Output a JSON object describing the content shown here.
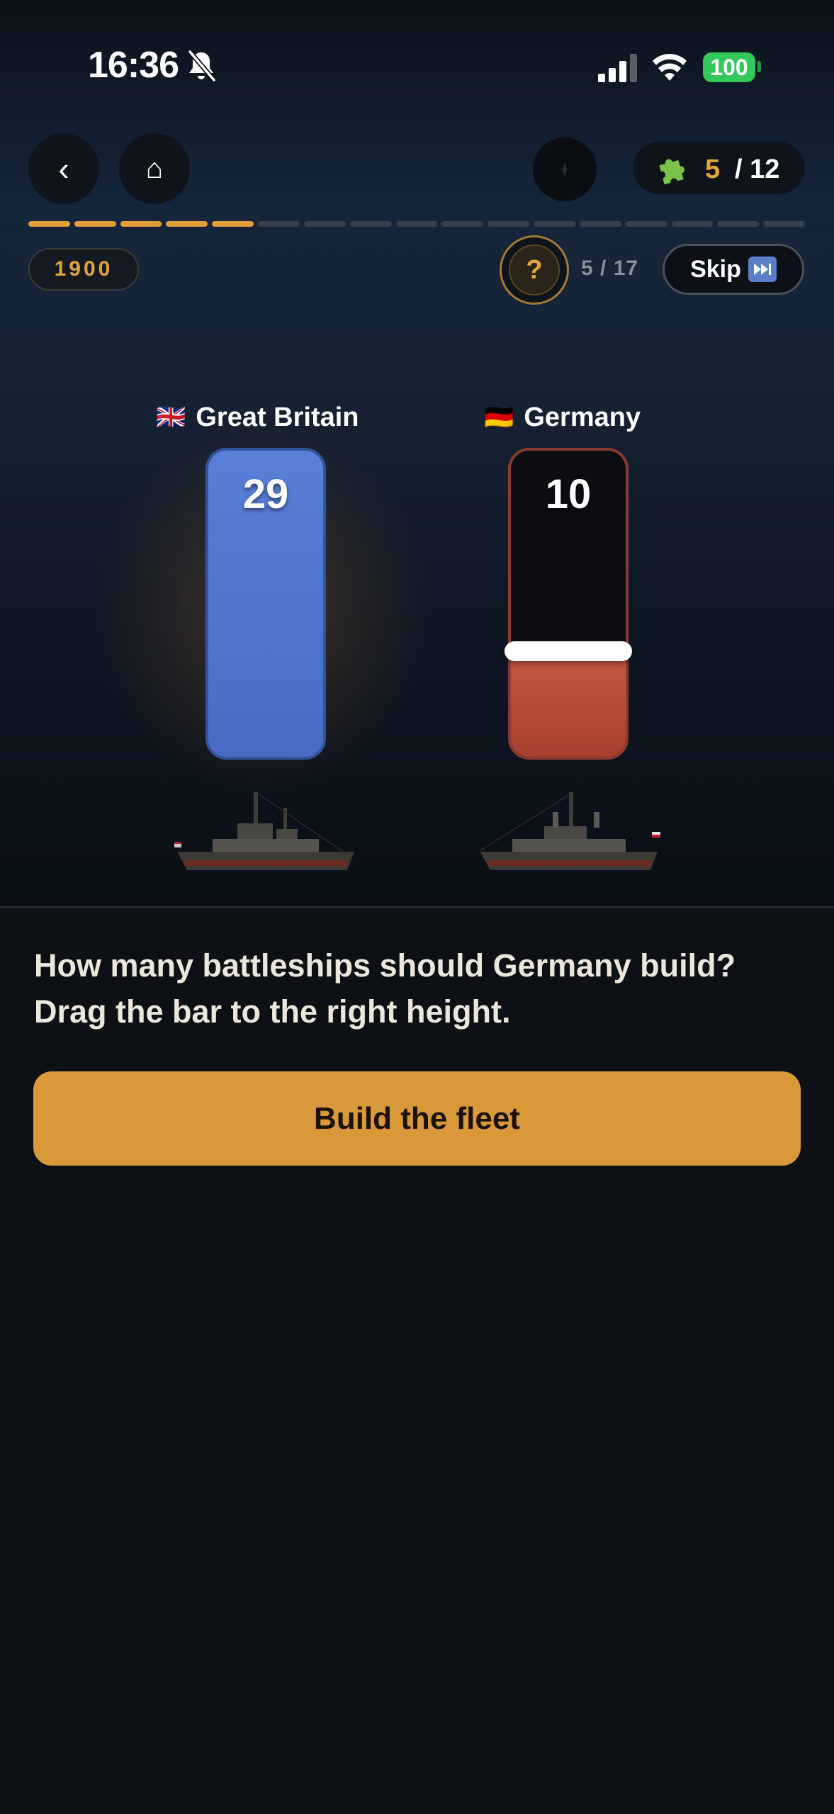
{
  "status_bar": {
    "time": "16:36",
    "battery": "100"
  },
  "nav": {
    "back_glyph": "‹",
    "home_glyph": "⌂",
    "compass_icon": "compass-icon"
  },
  "puzzle": {
    "count": "5",
    "total": "/ 12",
    "icon": "puzzle-icon"
  },
  "progress": {
    "completed": 5,
    "total": 17
  },
  "quiz": {
    "year": "1900",
    "help_glyph": "?",
    "question_count": "5 / 17",
    "skip_label": "Skip",
    "skip_icon": "⏭"
  },
  "chart_data": {
    "type": "bar",
    "categories": [
      "Great Britain",
      "Germany"
    ],
    "values": [
      29,
      10
    ],
    "flags": [
      "🇬🇧",
      "🇩🇪"
    ],
    "colors": [
      "#4f74d2",
      "#b9503a"
    ],
    "ylim": [
      0,
      29
    ]
  },
  "labels": {
    "gb_flag": "🇬🇧",
    "gb_name": "Great Britain",
    "gb_value": "29",
    "de_flag": "🇩🇪",
    "de_name": "Germany",
    "de_value": "10"
  },
  "prompt": {
    "line1": "How many battleships should Germany build?",
    "line2": "Drag the bar to the right height."
  },
  "action": {
    "build_label": "Build the fleet"
  },
  "colors": {
    "accent": "#e29e38",
    "gb_bar": "#4f74d2",
    "de_bar": "#b9503a",
    "battery": "#34c759"
  }
}
